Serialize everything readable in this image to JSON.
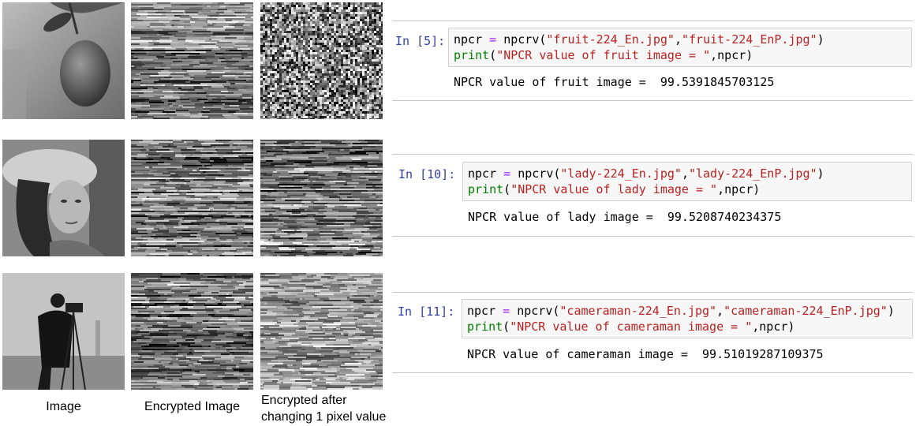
{
  "columns": {
    "original": "Image",
    "encrypted": "Encrypted Image",
    "changed_line1": "Encrypted after",
    "changed_line2": "changing 1 pixel value"
  },
  "cells": [
    {
      "prompt": "In [5]:",
      "line1": {
        "var": "npcr",
        "eq": "=",
        "fn": "npcrv(",
        "arg1": "\"fruit-224_En.jpg\"",
        "comma": ",",
        "arg2": "\"fruit-224_EnP.jpg\"",
        "close": ")"
      },
      "line2": {
        "fn": "print",
        "open": "(",
        "str": "\"NPCR value of fruit image = \"",
        "rest": ",npcr)"
      },
      "output": "NPCR value of fruit image =  99.5391845703125"
    },
    {
      "prompt": "In [10]:",
      "line1": {
        "var": "npcr",
        "eq": "=",
        "fn": "npcrv(",
        "arg1": "\"lady-224_En.jpg\"",
        "comma": ",",
        "arg2": "\"lady-224_EnP.jpg\"",
        "close": ")"
      },
      "line2": {
        "fn": "print",
        "open": "(",
        "str": "\"NPCR value of lady image = \"",
        "rest": ",npcr)"
      },
      "output": "NPCR value of lady image =  99.5208740234375"
    },
    {
      "prompt": "In [11]:",
      "line1": {
        "var": "npcr",
        "eq": "=",
        "fn": "npcrv(",
        "arg1": "\"cameraman-224_En.jpg\"",
        "comma": ",",
        "arg2": "\"cameraman-224_EnP.jpg\"",
        "close": ")"
      },
      "line2": {
        "fn": "print",
        "open": "(",
        "str": "\"NPCR value of cameraman image = \"",
        "rest": ",npcr)"
      },
      "output": "NPCR value of cameraman image =  99.51019287109375"
    }
  ]
}
